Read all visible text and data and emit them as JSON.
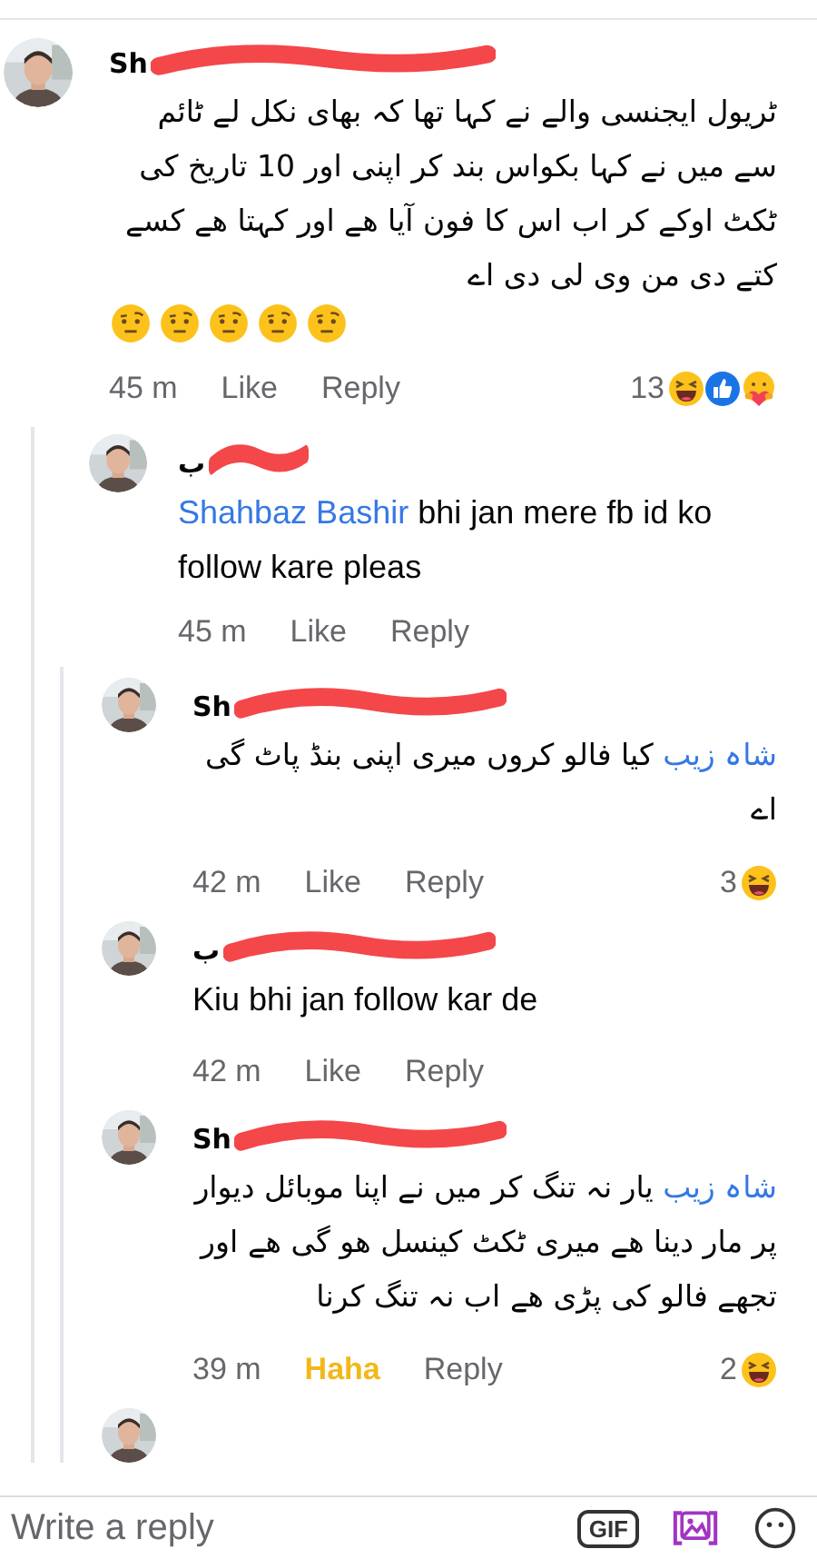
{
  "comments": [
    {
      "avatar": {
        "kind": "picture"
      },
      "name": "Sh",
      "redacted": true,
      "text": "ٹریول ایجنسی والے نے کہا تھا کہ بھای نکل لے ٹائم سے میں نے کہا بکواس بند کر اپنی اور 10 تاریخ کی ٹکٹ اوکے کر اب اس کا  فون آیا ھے اور کہتا ھے کسے کتے دی من وی لی دی اے",
      "emojis": [
        {
          "kind": "raised-eyebrow"
        },
        {
          "kind": "raised-eyebrow"
        },
        {
          "kind": "raised-eyebrow"
        },
        {
          "kind": "raised-eyebrow"
        },
        {
          "kind": "raised-eyebrow"
        }
      ],
      "time": "45 m",
      "like": {
        "label": "Like",
        "reacted": false
      },
      "reply": "Reply",
      "reaction_count": "13",
      "reactions": [
        {
          "kind": "haha"
        },
        {
          "kind": "like"
        },
        {
          "kind": "care"
        }
      ],
      "children": [
        {
          "avatar": {
            "kind": "picture"
          },
          "name": "ب",
          "redacted": true,
          "mention": "Shahbaz Bashir",
          "text": "bhi jan mere fb id ko follow kare pleas",
          "time": "45 m",
          "like": {
            "label": "Like",
            "reacted": false
          },
          "reply": "Reply",
          "children": [
            {
              "avatar": {
                "kind": "picture"
              },
              "name": "Sh",
              "redacted": true,
              "mention": "شاہ زیب",
              "text": "کیا فالو کروں میری اپنی بنڈ پاٹ گی اے",
              "time": "42 m",
              "like": {
                "label": "Like",
                "reacted": false
              },
              "reply": "Reply",
              "reaction_count": "3",
              "reactions": [
                {
                  "kind": "haha"
                }
              ]
            },
            {
              "avatar": {
                "kind": "picture"
              },
              "name": "ب",
              "redacted": true,
              "text": "Kiu bhi jan follow kar de",
              "time": "42 m",
              "like": {
                "label": "Like",
                "reacted": false
              },
              "reply": "Reply"
            },
            {
              "avatar": {
                "kind": "picture"
              },
              "name": "Sh",
              "redacted": true,
              "mention": "شاہ زیب",
              "text": "یار نہ تنگ کر میں نے اپنا موبائل دیوار پر مار دینا ھے میری ٹکٹ کینسل ھو گی ھے اور تجھے فالو کی پڑی ھے اب نہ تنگ کرنا",
              "time": "39 m",
              "like": {
                "label": "Haha",
                "reacted": true
              },
              "reply": "Reply",
              "reaction_count": "2",
              "reactions": [
                {
                  "kind": "haha"
                }
              ]
            },
            {
              "avatar": {
                "kind": "picture"
              }
            }
          ]
        }
      ]
    }
  ],
  "composer": {
    "placeholder": "Write a reply",
    "gif": "GIF"
  }
}
